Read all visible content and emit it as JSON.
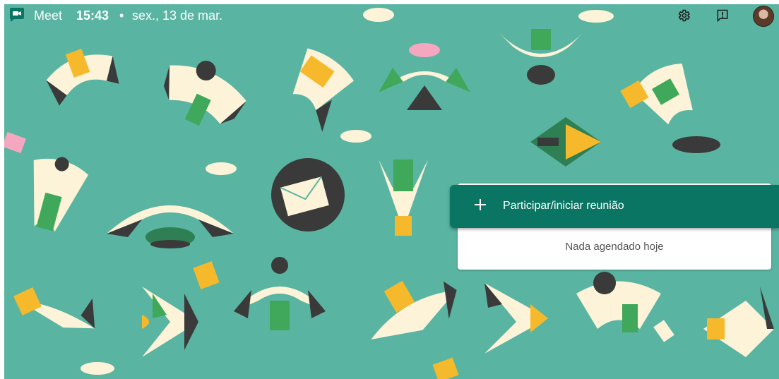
{
  "header": {
    "app_name": "Meet",
    "time": "15:43",
    "separator": "•",
    "date": "sex., 13 de mar."
  },
  "icons": {
    "logo": "meet-logo-icon",
    "settings": "gear-icon",
    "feedback": "feedback-icon",
    "avatar": "user-avatar"
  },
  "main": {
    "join_button_label": "Participar/iniciar reunião",
    "empty_schedule_message": "Nada agendado hoje"
  },
  "colors": {
    "background": "#5ab4a2",
    "join_button": "#0b7564",
    "card": "#ffffff"
  }
}
